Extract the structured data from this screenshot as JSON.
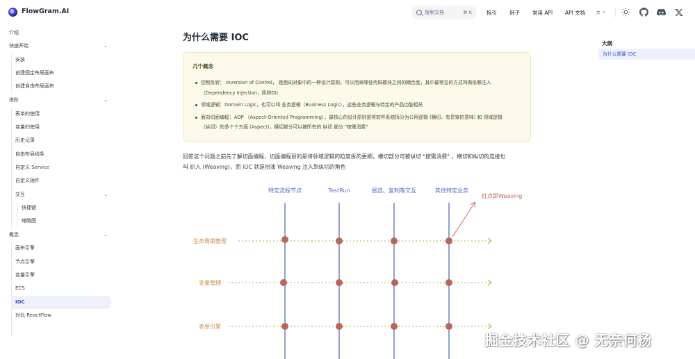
{
  "header": {
    "brand": "FlowGram.AI",
    "search_placeholder": "搜索文档",
    "search_kbd": "⌘ K",
    "nav": [
      "指引",
      "例子",
      "常用 API",
      "API 文档"
    ],
    "lang_icon": "translate-icon",
    "icons": [
      "sun-icon",
      "github-icon",
      "discord-icon",
      "x-icon"
    ]
  },
  "sidebar": {
    "items": [
      {
        "label": "介绍"
      },
      {
        "label": "快速开始"
      },
      {
        "label": "安装"
      },
      {
        "label": "创建固定布局画布"
      },
      {
        "label": "创建自由布局画布"
      },
      {
        "label": "进阶"
      },
      {
        "label": "表单的使用"
      },
      {
        "label": "变量的使用"
      },
      {
        "label": "历史记录"
      },
      {
        "label": "自由布局线条"
      },
      {
        "label": "自定义 Service"
      },
      {
        "label": "自定义插件"
      },
      {
        "label": "交互"
      },
      {
        "label": "快捷键"
      },
      {
        "label": "缩略图"
      },
      {
        "label": "概念"
      },
      {
        "label": "画布引擎"
      },
      {
        "label": "节点引擎"
      },
      {
        "label": "变量引擎"
      },
      {
        "label": "ECS"
      },
      {
        "label": "IOC"
      },
      {
        "label": "对比 ReactFlow"
      }
    ]
  },
  "main": {
    "title": "为什么需要 IOC",
    "tip": {
      "title": "几个概念",
      "items": [
        {
          "line1": "控制反转： Inversion of Control， 是面向对象中的一种设计原则，可以用来降低代码模块之间的耦合度，其中最常见的方式叫做依赖注入",
          "line2": "（Dependency Injection，简称DI）"
        },
        {
          "line1": "领域逻辑：Domain Logic，也可以叫 业务逻辑（Business Logic），这些业务逻辑与特定的产品功能相关",
          "line2": ""
        },
        {
          "line1": "面向切面编程：AOP （Aspect-Oriented Programming），最核心的设计原则是将软件系统拆分为公用逻辑 (横切，有贯穿的意味) 和 领域逻辑",
          "line2": "（纵切）的多个个方面 (Aspect)，横切部分可以被所有的 纵切 部分 \"按需消费\""
        }
      ]
    },
    "para_line1": "回答这个问题之前先了解切面编程，切面编程目的是将领域逻辑的粒度拆的更细，横切部分可被纵切 \"按需消费\" ，横切和纵切的连接也",
    "para_line2": "叫 织入 (Weaving)，而 IOC 就是扮演 Weaving 注入到纵切的角色"
  },
  "diagram": {
    "columns": [
      "特定流程节点",
      "TestRun",
      "圈选、复制等交互",
      "其他特定业务"
    ],
    "rows": [
      "生命周期管理",
      "变量管理",
      "表单引擎"
    ],
    "annotation": "红点即Weaving",
    "colors": {
      "vertical": "#5b6bbd",
      "row_text": "#c98b4a",
      "dot": "#b5685a",
      "arrow": "#c9665d",
      "row_arrow": "#9fb34c"
    }
  },
  "outline": {
    "title": "大纲",
    "items": [
      "为什么需要 IOC"
    ]
  },
  "watermark": "掘金技术社区 @ 无奈何杨"
}
